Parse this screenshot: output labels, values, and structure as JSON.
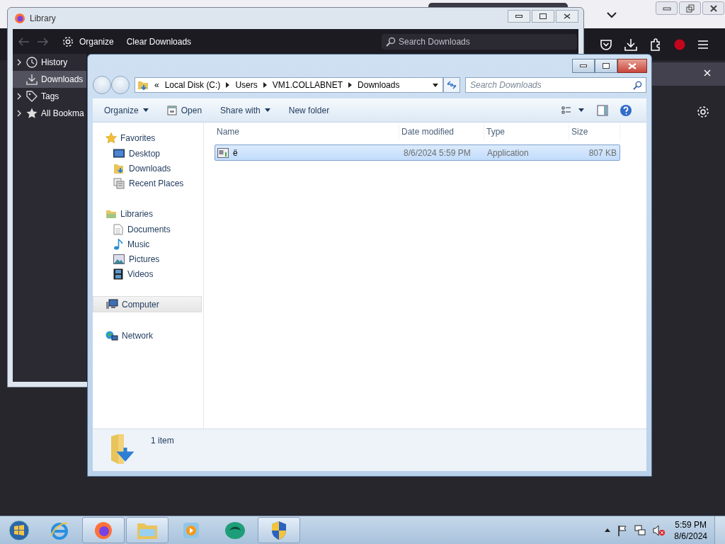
{
  "library": {
    "title": "Library",
    "toolbar": {
      "organize": "Organize",
      "clear": "Clear Downloads",
      "search": {
        "placeholder": "Search Downloads"
      }
    },
    "sidebar": [
      {
        "label": "History",
        "expandable": true,
        "selected": false
      },
      {
        "label": "Downloads",
        "expandable": false,
        "selected": true
      },
      {
        "label": "Tags",
        "expandable": true,
        "selected": false
      },
      {
        "label": "All Bookma",
        "expandable": true,
        "selected": false
      }
    ]
  },
  "explorer": {
    "breadcrumb": {
      "overflow": "«",
      "parts": [
        "Local Disk (C:)",
        "Users",
        "VM1.COLLABNET",
        "Downloads"
      ]
    },
    "search": {
      "placeholder": "Search Downloads"
    },
    "toolbar": [
      {
        "label": "Organize",
        "dropdown": true
      },
      {
        "label": "Open",
        "dropdown": false
      },
      {
        "label": "Share with",
        "dropdown": true
      },
      {
        "label": "New folder",
        "dropdown": false
      }
    ],
    "nav": [
      {
        "label": "Favorites",
        "selected": false,
        "children": [
          {
            "label": "Desktop",
            "selected": false
          },
          {
            "label": "Downloads",
            "selected": false
          },
          {
            "label": "Recent Places",
            "selected": false
          }
        ]
      },
      {
        "label": "Libraries",
        "selected": false,
        "children": [
          {
            "label": "Documents",
            "selected": false
          },
          {
            "label": "Music",
            "selected": false
          },
          {
            "label": "Pictures",
            "selected": false
          },
          {
            "label": "Videos",
            "selected": false
          }
        ]
      },
      {
        "label": "Computer",
        "selected": true
      },
      {
        "label": "Network",
        "selected": false
      }
    ],
    "columns": [
      "Name",
      "Date modified",
      "Type",
      "Size"
    ],
    "rows": [
      {
        "name": "ë",
        "date": "8/6/2024 5:59 PM",
        "type": "Application",
        "size": "807 KB",
        "selected": true
      }
    ],
    "status": "1 item"
  },
  "taskbar": {
    "apps": [
      {
        "running": false
      },
      {
        "running": true
      },
      {
        "running": true
      },
      {
        "running": false
      },
      {
        "running": false
      },
      {
        "running": true
      }
    ],
    "time": "5:59 PM",
    "date": "8/6/2024"
  }
}
